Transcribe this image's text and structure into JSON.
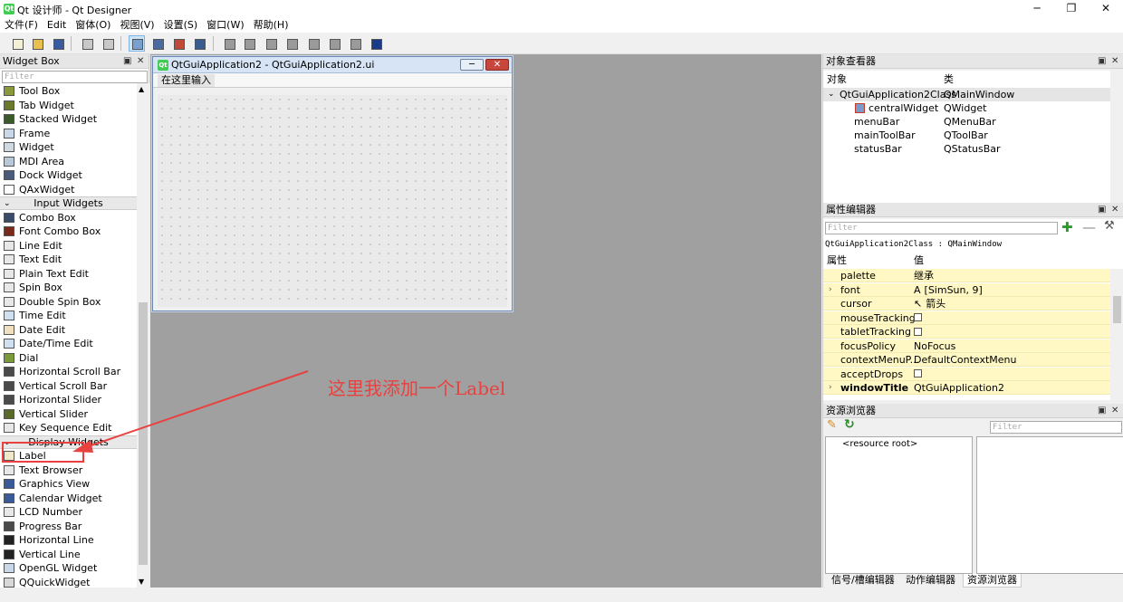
{
  "window": {
    "title": "Qt 设计师 - Qt Designer",
    "min": "─",
    "max": "❐",
    "close": "✕",
    "app_icon": "qt-icon"
  },
  "menus": [
    "文件(F)",
    "Edit",
    "窗体(O)",
    "视图(V)",
    "设置(S)",
    "窗口(W)",
    "帮助(H)"
  ],
  "widget_box": {
    "title": "Widget Box",
    "filter_placeholder": "Filter",
    "items": [
      {
        "label": "Tool Box",
        "icon": "toolbox-icon",
        "color": "#8a9a3a"
      },
      {
        "label": "Tab Widget",
        "icon": "tab-widget-icon",
        "color": "#6a7a2a"
      },
      {
        "label": "Stacked Widget",
        "icon": "stacked-widget-icon",
        "color": "#3a5a2a"
      },
      {
        "label": "Frame",
        "icon": "frame-icon",
        "color": "#c8d8e8"
      },
      {
        "label": "Widget",
        "icon": "widget-icon",
        "color": "#d0d8e0"
      },
      {
        "label": "MDI Area",
        "icon": "mdi-area-icon",
        "color": "#b8c8d8"
      },
      {
        "label": "Dock Widget",
        "icon": "dock-widget-icon",
        "color": "#4a5a7a"
      },
      {
        "label": "QAxWidget",
        "icon": "ax-widget-icon",
        "color": "#ffffff"
      },
      {
        "category": "Input Widgets"
      },
      {
        "label": "Combo Box",
        "icon": "combo-box-icon",
        "color": "#3a4a6a"
      },
      {
        "label": "Font Combo Box",
        "icon": "font-combo-box-icon",
        "color": "#7a2a1a"
      },
      {
        "label": "Line Edit",
        "icon": "line-edit-icon",
        "color": "#e8e8e8"
      },
      {
        "label": "Text Edit",
        "icon": "text-edit-icon",
        "color": "#e8e8e8"
      },
      {
        "label": "Plain Text Edit",
        "icon": "plain-text-edit-icon",
        "color": "#e8e8e8"
      },
      {
        "label": "Spin Box",
        "icon": "spin-box-icon",
        "color": "#e8e8e8"
      },
      {
        "label": "Double Spin Box",
        "icon": "double-spin-box-icon",
        "color": "#e8e8e8"
      },
      {
        "label": "Time Edit",
        "icon": "time-edit-icon",
        "color": "#cfe0f0"
      },
      {
        "label": "Date Edit",
        "icon": "date-edit-icon",
        "color": "#f0e0c0"
      },
      {
        "label": "Date/Time Edit",
        "icon": "datetime-edit-icon",
        "color": "#cfe0f0"
      },
      {
        "label": "Dial",
        "icon": "dial-icon",
        "color": "#7a9a3a"
      },
      {
        "label": "Horizontal Scroll Bar",
        "icon": "hscrollbar-icon",
        "color": "#4a4a4a"
      },
      {
        "label": "Vertical Scroll Bar",
        "icon": "vscrollbar-icon",
        "color": "#4a4a4a"
      },
      {
        "label": "Horizontal Slider",
        "icon": "hslider-icon",
        "color": "#4a4a4a"
      },
      {
        "label": "Vertical Slider",
        "icon": "vslider-icon",
        "color": "#5a6a2a"
      },
      {
        "label": "Key Sequence Edit",
        "icon": "key-sequence-edit-icon",
        "color": "#e8e8e8"
      },
      {
        "category": "Display Widgets"
      },
      {
        "label": "Label",
        "icon": "label-icon",
        "color": "#f0e8c8"
      },
      {
        "label": "Text Browser",
        "icon": "text-browser-icon",
        "color": "#e8e8e8"
      },
      {
        "label": "Graphics View",
        "icon": "graphics-view-icon",
        "color": "#3a5a9a"
      },
      {
        "label": "Calendar Widget",
        "icon": "calendar-icon",
        "color": "#3a5a9a"
      },
      {
        "label": "LCD Number",
        "icon": "lcd-number-icon",
        "color": "#e8e8e8"
      },
      {
        "label": "Progress Bar",
        "icon": "progress-bar-icon",
        "color": "#4a4a4a"
      },
      {
        "label": "Horizontal Line",
        "icon": "hline-icon",
        "color": "#222222"
      },
      {
        "label": "Vertical Line",
        "icon": "vline-icon",
        "color": "#222222"
      },
      {
        "label": "OpenGL Widget",
        "icon": "opengl-icon",
        "color": "#c8d8e8"
      },
      {
        "label": "QQuickWidget",
        "icon": "quick-widget-icon",
        "color": "#d8d8d8"
      }
    ]
  },
  "form": {
    "title": "QtGuiApplication2 - QtGuiApplication2.ui",
    "menu_placeholder": "在这里输入",
    "min": "─",
    "close": "✕"
  },
  "annotation": {
    "text": "这里我添加一个Label",
    "color": "#e8413f"
  },
  "object_inspector": {
    "title": "对象查看器",
    "col_object": "对象",
    "col_class": "类",
    "rows": [
      {
        "name": "QtGuiApplication2Class",
        "cls": "QMainWindow",
        "indent": 0,
        "expanded": true
      },
      {
        "name": "centralWidget",
        "cls": "QWidget",
        "indent": 2,
        "icon": "widget-icon"
      },
      {
        "name": "menuBar",
        "cls": "QMenuBar",
        "indent": 1
      },
      {
        "name": "mainToolBar",
        "cls": "QToolBar",
        "indent": 1
      },
      {
        "name": "statusBar",
        "cls": "QStatusBar",
        "indent": 1
      }
    ]
  },
  "property_editor": {
    "title": "属性编辑器",
    "filter_placeholder": "Filter",
    "context": "QtGuiApplication2Class : QMainWindow",
    "col_property": "属性",
    "col_value": "值",
    "rows": [
      {
        "name": "palette",
        "value": "继承"
      },
      {
        "name": "font",
        "value": "[SimSun, 9]",
        "prefix": "A",
        "expandable": true
      },
      {
        "name": "cursor",
        "value": "箭头",
        "prefix": "↖"
      },
      {
        "name": "mouseTracking",
        "checkbox": true
      },
      {
        "name": "tabletTracking",
        "checkbox": true
      },
      {
        "name": "focusPolicy",
        "value": "NoFocus"
      },
      {
        "name": "contextMenuP...",
        "value": "DefaultContextMenu"
      },
      {
        "name": "acceptDrops",
        "checkbox": true
      },
      {
        "name": "windowTitle",
        "value": "QtGuiApplication2",
        "bold": true,
        "expandable": true
      }
    ]
  },
  "resource_browser": {
    "title": "资源浏览器",
    "filter_placeholder": "Filter",
    "root": "<resource root>",
    "tabs": [
      "信号/槽编辑器",
      "动作编辑器",
      "资源浏览器"
    ],
    "active_tab": 2
  }
}
